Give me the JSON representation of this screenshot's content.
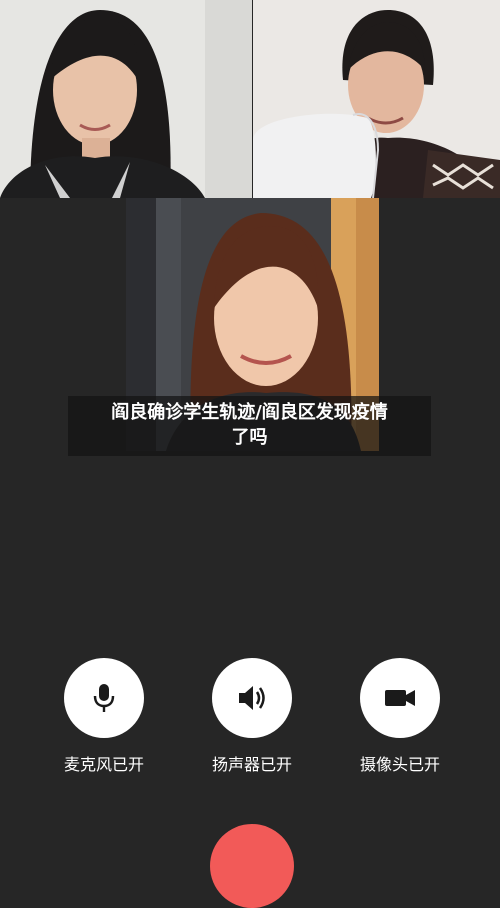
{
  "caption": {
    "line1": "阎良确诊学生轨迹/阎良区发现疫情",
    "line2": "了吗"
  },
  "controls": [
    {
      "label": "麦克风已开",
      "icon": "microphone-icon"
    },
    {
      "label": "扬声器已开",
      "icon": "speaker-icon"
    },
    {
      "label": "摄像头已开",
      "icon": "camera-icon"
    }
  ],
  "colors": {
    "background": "#262626",
    "control_button": "#ffffff",
    "hangup": "#f25a58"
  }
}
